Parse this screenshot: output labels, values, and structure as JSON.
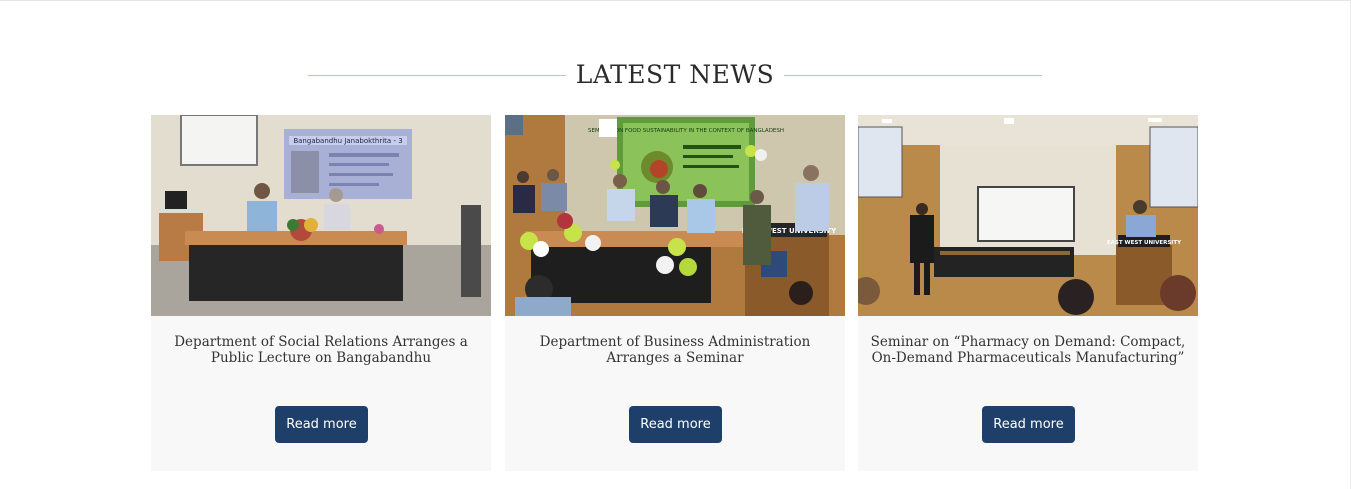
{
  "section": {
    "heading": "LATEST NEWS"
  },
  "colors": {
    "accent_rule": "#d8c08a",
    "button_bg": "#1f3f6b",
    "card_bg": "#f8f8f8"
  },
  "news": [
    {
      "title": "Department of Social Relations Arranges a Public Lecture on Bangabandhu",
      "button_label": "Read more",
      "banner_title": "Bangabandhu Janabokthrita - 3"
    },
    {
      "title": "Department of Business Administration Arranges a Seminar",
      "button_label": "Read more",
      "banner_title": "SEMINAR ON FOOD SUSTAINABILITY IN THE CONTEXT OF BANGLADESH",
      "podium_text": "EAST WEST UNIVERSITY"
    },
    {
      "title": "Seminar on “Pharmacy on Demand: Compact, On-Demand Pharmaceuticals Manufacturing”",
      "button_label": "Read more",
      "podium_text": "EAST WEST UNIVERSITY"
    }
  ]
}
